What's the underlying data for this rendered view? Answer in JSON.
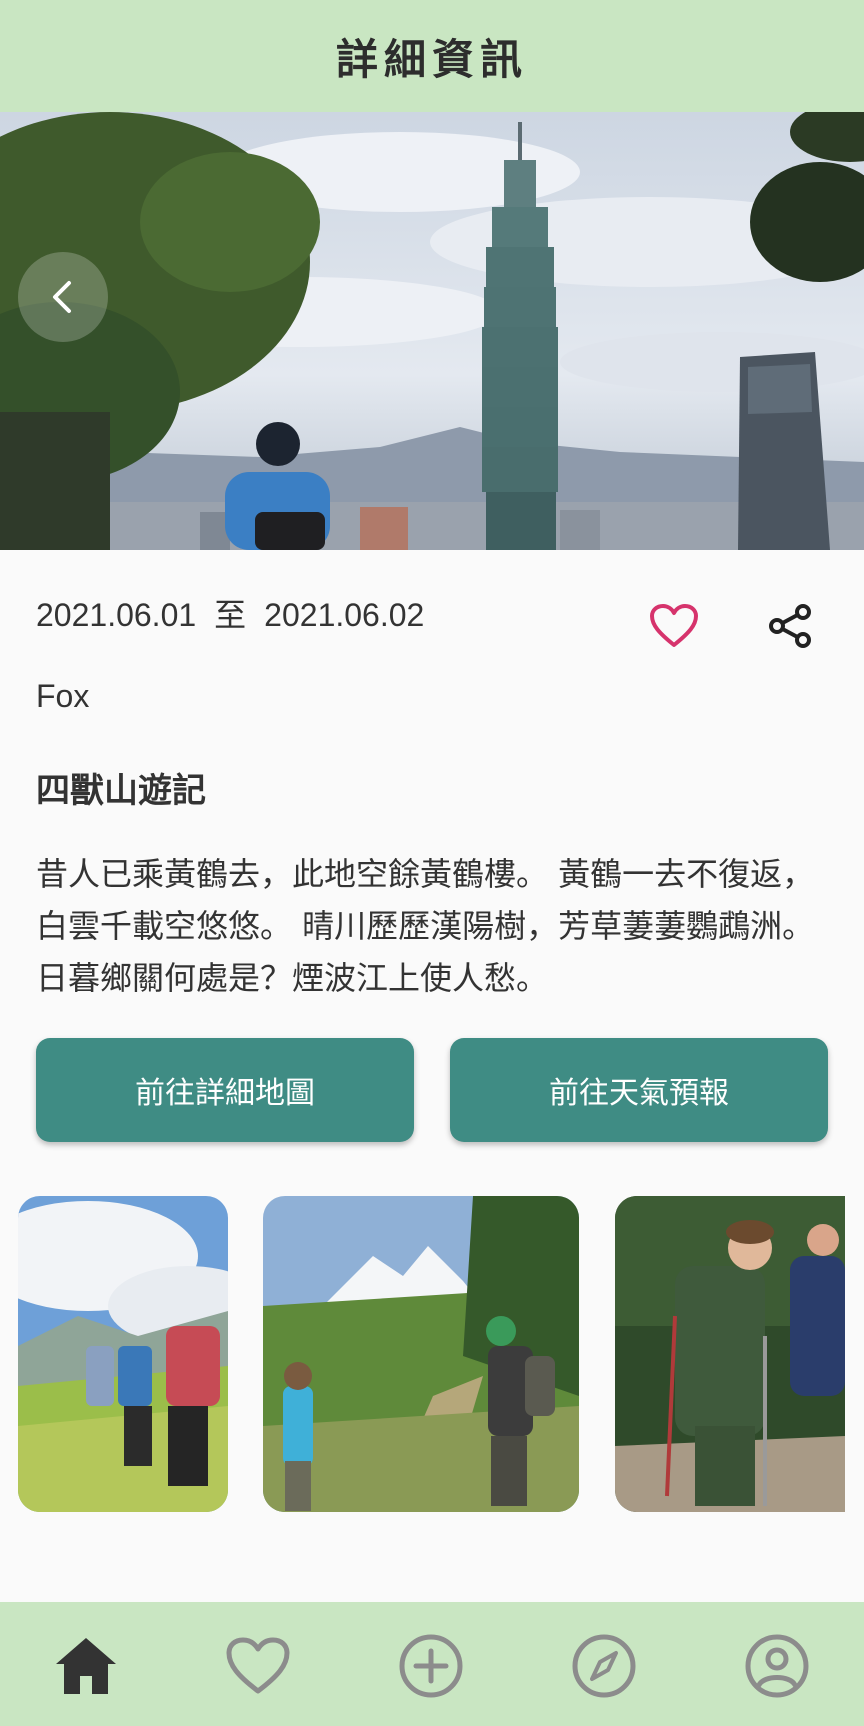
{
  "header": {
    "title": "詳細資訊"
  },
  "post": {
    "date_start": "2021.06.01",
    "date_separator": "至",
    "date_end": "2021.06.02",
    "author": "Fox",
    "title": "四獸山遊記",
    "body": "昔人已乘黃鶴去，此地空餘黃鶴樓。 黃鶴一去不復返，白雲千載空悠悠。 晴川歷歷漢陽樹，芳草萋萋鸚鵡洲。 日暮鄉關何處是？煙波江上使人愁。"
  },
  "actions": {
    "map_label": "前往詳細地圖",
    "weather_label": "前往天氣預報"
  },
  "icons": {
    "back": "chevron-left-icon",
    "favorite": "heart-outline-icon",
    "share": "share-icon"
  },
  "bottom_nav": {
    "items": [
      {
        "icon": "home-icon",
        "active": true
      },
      {
        "icon": "heart-outline-icon",
        "active": false
      },
      {
        "icon": "add-circle-icon",
        "active": false
      },
      {
        "icon": "compass-icon",
        "active": false
      },
      {
        "icon": "account-icon",
        "active": false
      }
    ]
  },
  "colors": {
    "header_bg": "#c9e6c2",
    "button_bg": "#3f8c84",
    "heart": "#d6336c",
    "nav_active": "#333333",
    "nav_inactive": "#8c8c8c"
  }
}
